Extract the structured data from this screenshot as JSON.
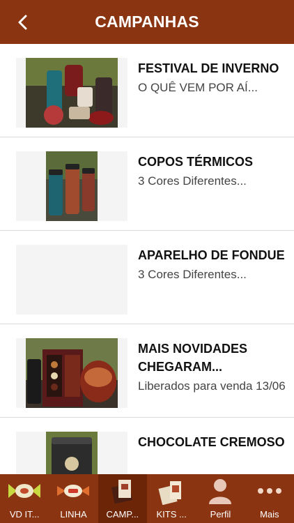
{
  "header": {
    "title": "CAMPANHAS"
  },
  "items": [
    {
      "title": "FESTIVAL DE INVERNO",
      "subtitle": "O QUÊ VEM POR AÍ..."
    },
    {
      "title": "COPOS TÉRMICOS",
      "subtitle": "3 Cores Diferentes..."
    },
    {
      "title": "APARELHO DE FONDUE",
      "subtitle": "3 Cores Diferentes..."
    },
    {
      "title": "MAIS NOVIDADES CHEGARAM...",
      "subtitle": "Liberados para venda 13/06"
    },
    {
      "title": "CHOCOLATE CREMOSO",
      "subtitle": ""
    }
  ],
  "tabs": [
    {
      "label": "VD IT...",
      "icon": "candy-icon"
    },
    {
      "label": "LINHA",
      "icon": "bonbon-icon"
    },
    {
      "label": "CAMP...",
      "icon": "chocolate-box-icon"
    },
    {
      "label": "KITS ...",
      "icon": "gift-kit-icon"
    },
    {
      "label": "Perfil",
      "icon": "user-icon"
    },
    {
      "label": "Mais",
      "icon": "more-dots-icon"
    }
  ],
  "colors": {
    "brand": "#8a3411",
    "brand_dark": "#6d2508"
  }
}
